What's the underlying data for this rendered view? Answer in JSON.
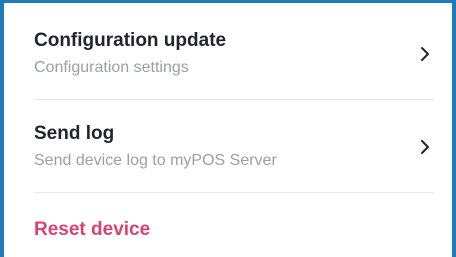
{
  "settings": {
    "items": [
      {
        "title": "Configuration update",
        "subtitle": "Configuration settings",
        "icon": "chevron-right-icon"
      },
      {
        "title": "Send log",
        "subtitle": "Send device log to myPOS Server",
        "icon": "chevron-right-icon"
      }
    ],
    "reset_label": "Reset device"
  },
  "colors": {
    "frame_border": "#1e7ab8",
    "title_text": "#1f2430",
    "subtitle_text": "#9aa0a8",
    "danger_text": "#d9436f",
    "divider": "#e4e6ea"
  }
}
